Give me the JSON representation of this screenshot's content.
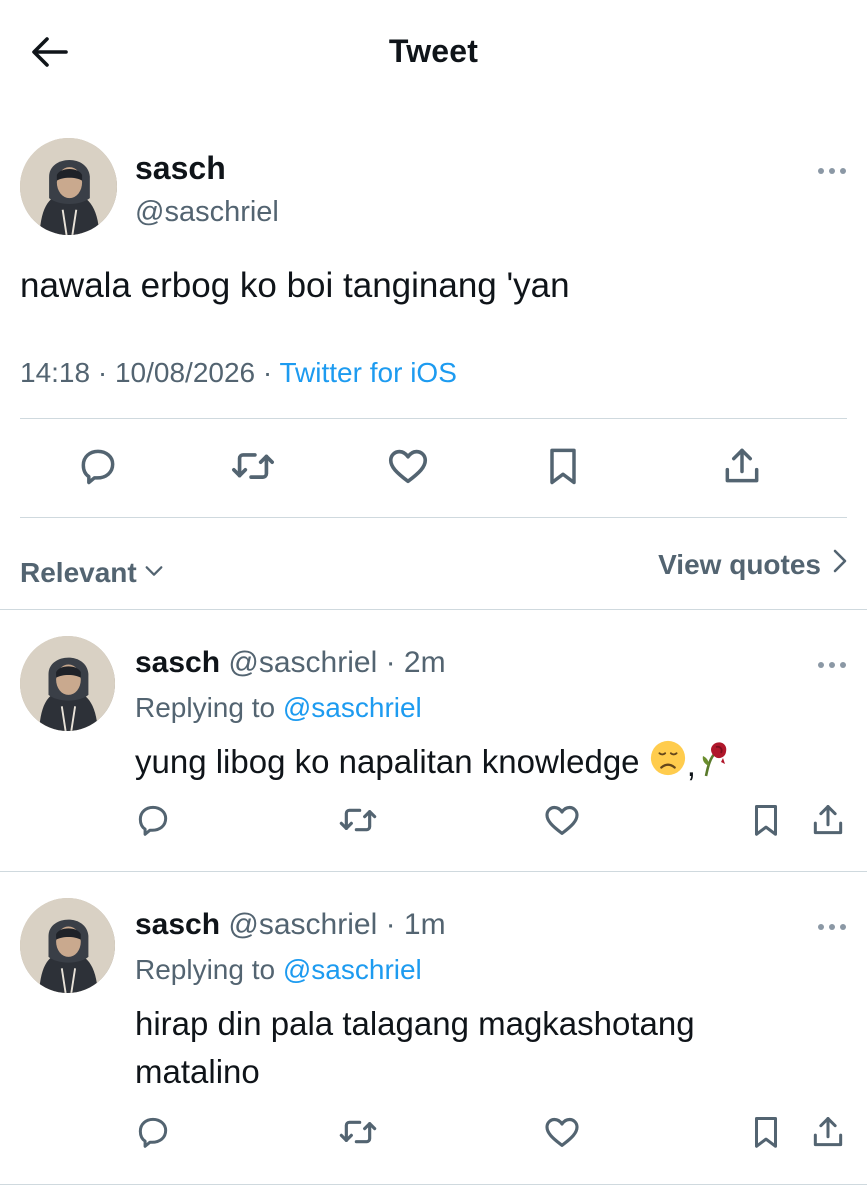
{
  "header": {
    "title": "Tweet",
    "back_icon": "arrow-left-icon"
  },
  "main_tweet": {
    "name": "sasch",
    "handle": "@saschriel",
    "text": "nawala erbog ko boi tanginang 'yan",
    "time": "14:18",
    "date": "10/08/2026",
    "source": "Twitter for iOS",
    "separator": " · "
  },
  "sort": {
    "label": "Relevant",
    "icon": "chevron-down-icon"
  },
  "view_quotes": {
    "label": "View quotes",
    "icon": "chevron-right-icon"
  },
  "replies": [
    {
      "name": "sasch",
      "handle": "@saschriel",
      "separator": " · ",
      "time": "2m",
      "replying_prefix": "Replying to ",
      "replying_to": "@saschriel",
      "text": "yung libog ko napalitan knowledge",
      "emojis": [
        "disappointed-face-emoji",
        "wilted-rose-emoji"
      ]
    },
    {
      "name": "sasch",
      "handle": "@saschriel",
      "separator": " · ",
      "time": "1m",
      "replying_prefix": "Replying to ",
      "replying_to": "@saschriel",
      "text_line1": "hirap din pala talagang magkashotang",
      "text_line2": "matalino"
    }
  ],
  "colors": {
    "text": "#0f1419",
    "secondary": "#536471",
    "accent": "#1d9bf0",
    "divider": "#cfd9de"
  }
}
